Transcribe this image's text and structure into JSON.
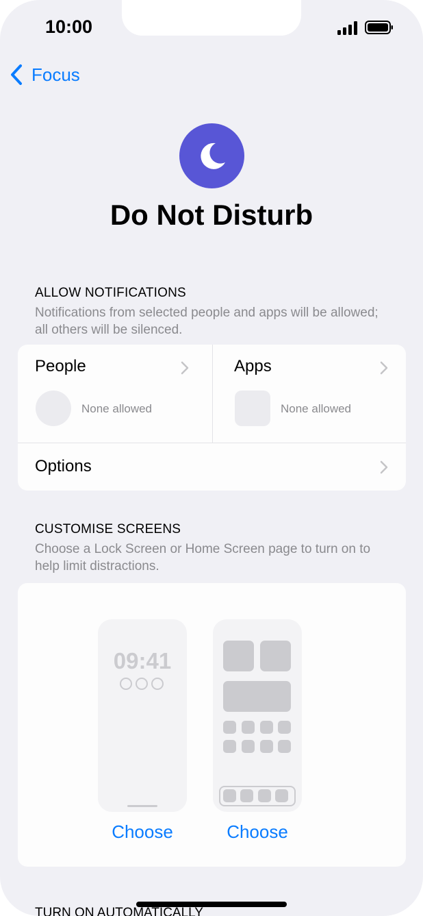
{
  "status_bar": {
    "time": "10:00",
    "signal_icon": "cellular-signal-icon",
    "battery_icon": "battery-icon"
  },
  "nav": {
    "back_label": "Focus",
    "back_icon": "chevron-left-icon"
  },
  "focus": {
    "icon": "moon-icon",
    "icon_color": "#5856d6",
    "title": "Do Not Disturb"
  },
  "allow_notifications": {
    "header": "ALLOW NOTIFICATIONS",
    "description": "Notifications from selected people and apps will be allowed; all others will be silenced.",
    "people": {
      "label": "People",
      "status": "None allowed"
    },
    "apps": {
      "label": "Apps",
      "status": "None allowed"
    },
    "options_label": "Options"
  },
  "customise_screens": {
    "header": "CUSTOMISE SCREENS",
    "description": "Choose a Lock Screen or Home Screen page to turn on to help limit distractions.",
    "lock_screen": {
      "time": "09:41",
      "choose_label": "Choose"
    },
    "home_screen": {
      "choose_label": "Choose"
    }
  },
  "turn_on_automatically": {
    "header": "TURN ON AUTOMATICALLY"
  },
  "colors": {
    "accent": "#0a7cff",
    "background": "#f0f0f5",
    "card": "#fdfdfd",
    "secondary_text": "#8a8a8e"
  }
}
